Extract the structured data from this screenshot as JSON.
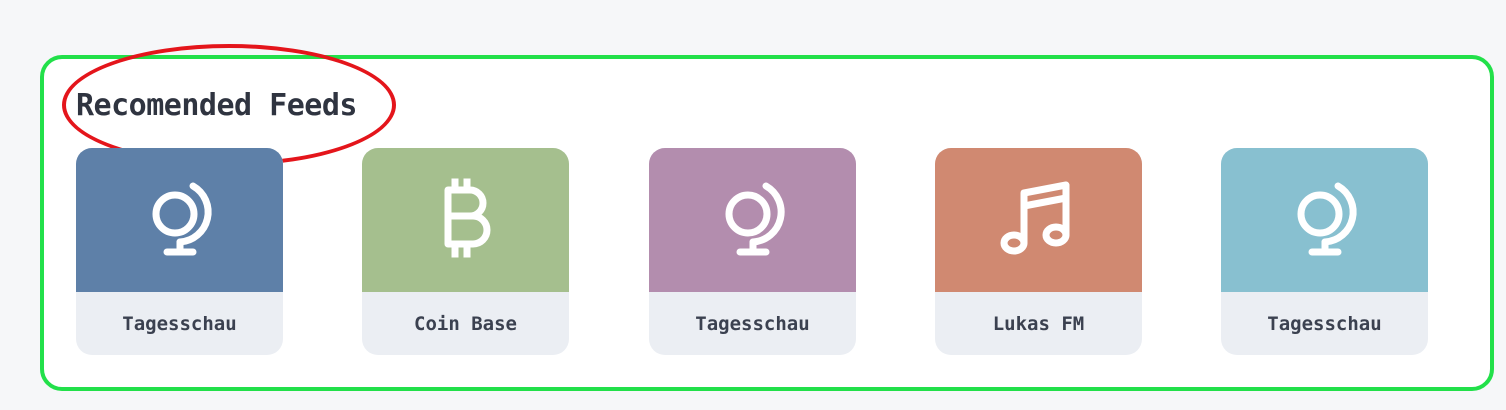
{
  "section": {
    "title": "Recomended Feeds"
  },
  "feeds": [
    {
      "label": "Tagesschau",
      "icon": "globe-icon",
      "color": "#5e80a8"
    },
    {
      "label": "Coin Base",
      "icon": "bitcoin-icon",
      "color": "#a5bf8e"
    },
    {
      "label": "Tagesschau",
      "icon": "globe-icon",
      "color": "#b38dae"
    },
    {
      "label": "Lukas FM",
      "icon": "music-note-icon",
      "color": "#d08971"
    },
    {
      "label": "Tagesschau",
      "icon": "globe-icon",
      "color": "#88c0d0"
    }
  ],
  "annotation_colors": {
    "panel_border": "#22e04a",
    "highlight_ellipse": "#e4151b"
  }
}
